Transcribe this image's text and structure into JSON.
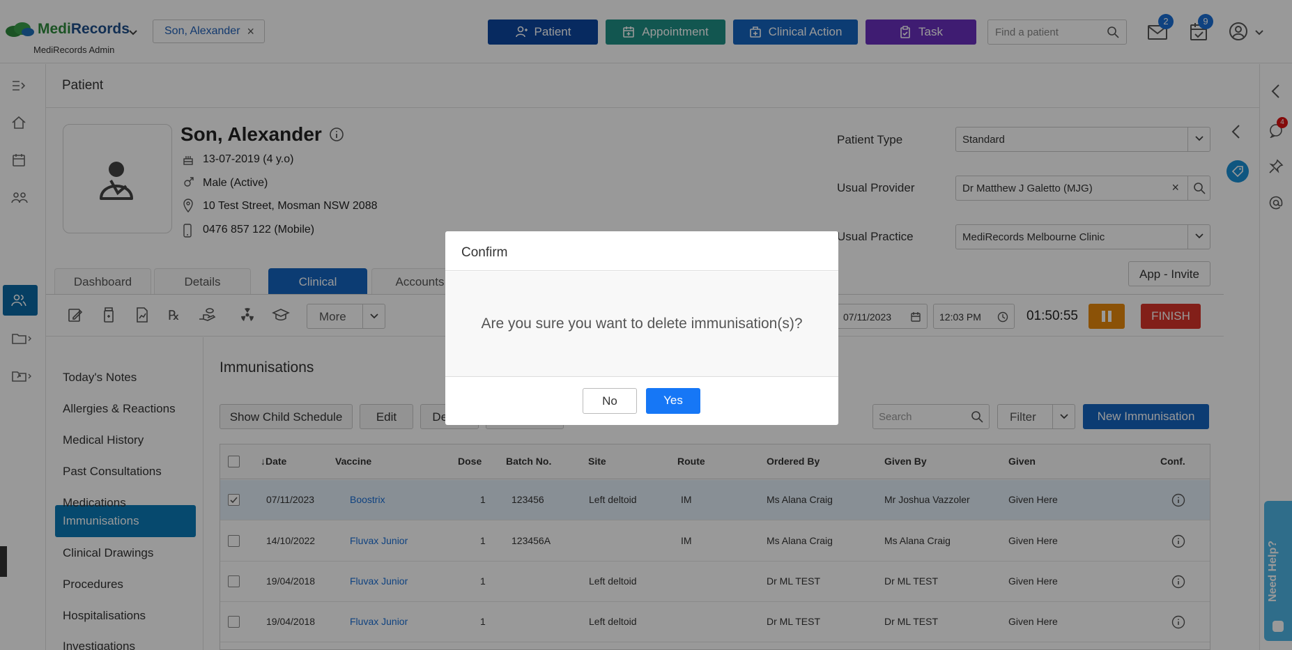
{
  "app": {
    "brand_a": "Medi",
    "brand_b": "Records",
    "subtitle": "MediRecords Admin"
  },
  "header": {
    "patient_chip": "Son, Alexander",
    "buttons": {
      "patient": "Patient",
      "appointment": "Appointment",
      "clinical_action": "Clinical Action",
      "task": "Task"
    },
    "search_placeholder": "Find a patient",
    "mail_count": "2",
    "tasks_count": "9"
  },
  "colors": {
    "patient_btn": "#0d47a1",
    "appointment_btn": "#1e8f86",
    "clinical_btn": "#1565c0",
    "task_btn": "#6a2fbf"
  },
  "page": {
    "title": "Patient"
  },
  "patient": {
    "name": "Son, Alexander",
    "dob": "13-07-2019 (4 y.o)",
    "gender": "Male (Active)",
    "address": "10 Test Street, Mosman NSW 2088",
    "phone": "0476 857 122 (Mobile)"
  },
  "fields": {
    "patient_type_label": "Patient Type",
    "patient_type": "Standard",
    "usual_provider_label": "Usual Provider",
    "usual_provider": "Dr Matthew J Galetto (MJG)",
    "usual_practice_label": "Usual Practice",
    "usual_practice": "MediRecords Melbourne Clinic",
    "app_invite": "App - Invite"
  },
  "tabs": {
    "dashboard": "Dashboard",
    "details": "Details",
    "clinical": "Clinical",
    "accounts": "Accounts"
  },
  "toolbar": {
    "more": "More",
    "date": "07/11/2023",
    "time": "12:03 PM",
    "timer": "01:50:55",
    "finish": "FINISH"
  },
  "leftnav": [
    "Today's Notes",
    "Allergies & Reactions",
    "Medical History",
    "Past Consultations",
    "Medications",
    "Immunisations",
    "Clinical Drawings",
    "Procedures",
    "Hospitalisations",
    "Investigations"
  ],
  "section": {
    "title": "Immunisations",
    "show_child_schedule": "Show Child Schedule",
    "edit": "Edit",
    "delete": "Delete",
    "search_placeholder": "Search",
    "filter": "Filter",
    "new_immunisation": "New Immunisation"
  },
  "table": {
    "columns": {
      "date": "Date",
      "vaccine": "Vaccine",
      "dose": "Dose",
      "batch": "Batch No.",
      "site": "Site",
      "route": "Route",
      "ordered_by": "Ordered By",
      "given_by": "Given By",
      "given": "Given",
      "conf": "Conf."
    },
    "rows": [
      {
        "date": "07/11/2023",
        "vaccine": "Boostrix",
        "dose": "1",
        "batch": "123456",
        "site": "Left deltoid",
        "route": "IM",
        "ordered_by": "Ms Alana Craig",
        "given_by": "Mr Joshua Vazzoler",
        "given": "Given Here"
      },
      {
        "date": "14/10/2022",
        "vaccine": "Fluvax Junior",
        "dose": "1",
        "batch": "123456A",
        "site": "",
        "route": "IM",
        "ordered_by": "Ms Alana Craig",
        "given_by": "Ms Alana Craig",
        "given": "Given Here"
      },
      {
        "date": "19/04/2018",
        "vaccine": "Fluvax Junior",
        "dose": "1",
        "batch": "",
        "site": "Left deltoid",
        "route": "",
        "ordered_by": "Dr ML TEST",
        "given_by": "Dr ML TEST",
        "given": "Given Here"
      },
      {
        "date": "19/04/2018",
        "vaccine": "Fluvax Junior",
        "dose": "1",
        "batch": "",
        "site": "Left deltoid",
        "route": "",
        "ordered_by": "Dr ML TEST",
        "given_by": "Dr ML TEST",
        "given": "Given Here"
      }
    ]
  },
  "rightrail": {
    "comments_count": "4"
  },
  "modal": {
    "title": "Confirm",
    "message": "Are you sure you want to delete immunisation(s)?",
    "no": "No",
    "yes": "Yes"
  },
  "help": {
    "label": "Need Help?"
  }
}
